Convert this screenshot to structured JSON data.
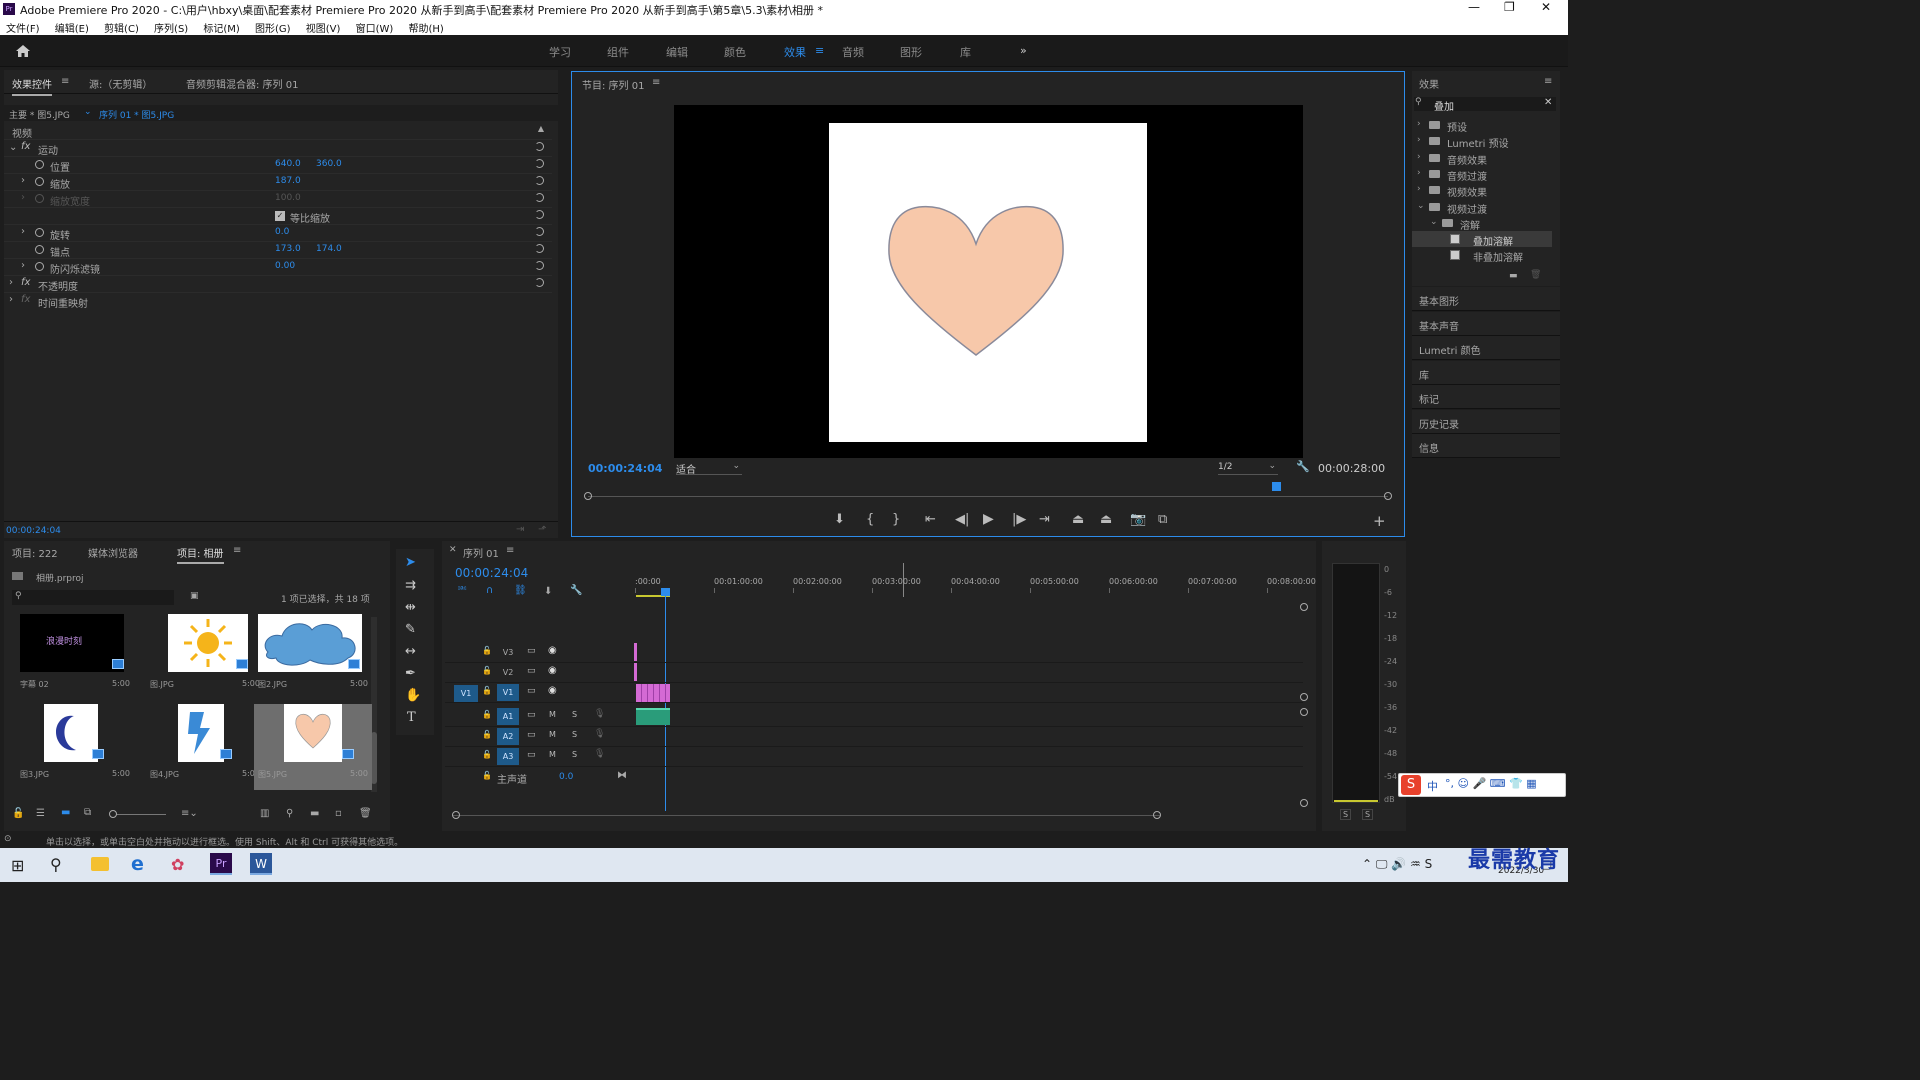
{
  "titlebar": {
    "title": "Adobe Premiere Pro 2020 - C:\\用户\\hbxy\\桌面\\配套素材 Premiere Pro 2020 从新手到高手\\配套素材 Premiere Pro 2020 从新手到高手\\第5章\\5.3\\素材\\相册 *"
  },
  "menu": [
    "文件(F)",
    "编辑(E)",
    "剪辑(C)",
    "序列(S)",
    "标记(M)",
    "图形(G)",
    "视图(V)",
    "窗口(W)",
    "帮助(H)"
  ],
  "workspaces": [
    "学习",
    "组件",
    "编辑",
    "颜色",
    "效果",
    "音频",
    "图形",
    "库"
  ],
  "active_workspace": "效果",
  "effect_controls": {
    "tabs": [
      "效果控件",
      "源:（无剪辑）",
      "音频剪辑混合器: 序列 01"
    ],
    "master": "主要 * 图5.JPG",
    "clip": "序列 01 * 图5.JPG",
    "section_video": "视频",
    "motion": "运动",
    "position_label": "位置",
    "position_x": "640.0",
    "position_y": "360.0",
    "scale_label": "缩放",
    "scale": "187.0",
    "scale_width_label": "缩放宽度",
    "scale_width": "100.0",
    "uniform_label": "等比缩放",
    "rotation_label": "旋转",
    "rotation": "0.0",
    "anchor_label": "锚点",
    "anchor_x": "173.0",
    "anchor_y": "174.0",
    "flicker_label": "防闪烁滤镜",
    "flicker": "0.00",
    "opacity": "不透明度",
    "time_remap": "时间重映射",
    "timecode": "00:00:24:04"
  },
  "program": {
    "title": "节目: 序列 01",
    "timecode": "00:00:24:04",
    "fit": "适合",
    "resolution": "1/2",
    "duration": "00:00:28:00",
    "playhead_fraction": 0.86
  },
  "effects": {
    "title": "效果",
    "search": "叠加",
    "items": [
      {
        "label": "预设",
        "level": 0
      },
      {
        "label": "Lumetri 预设",
        "level": 0
      },
      {
        "label": "音频效果",
        "level": 0
      },
      {
        "label": "音频过渡",
        "level": 0
      },
      {
        "label": "视频效果",
        "level": 0
      },
      {
        "label": "视频过渡",
        "level": 0
      },
      {
        "label": "溶解",
        "level": 1
      },
      {
        "label": "叠加溶解",
        "level": 2
      },
      {
        "label": "非叠加溶解",
        "level": 2
      }
    ],
    "panels": [
      "基本图形",
      "基本声音",
      "Lumetri 颜色",
      "库",
      "标记",
      "历史记录",
      "信息"
    ]
  },
  "project": {
    "tabs": [
      "项目: 222",
      "媒体浏览器",
      "项目: 相册"
    ],
    "file": "相册.prproj",
    "selection": "1 项已选择，共 18 项",
    "items": [
      {
        "name": "字幕 02",
        "dur": "5:00",
        "caption": "浪漫时刻"
      },
      {
        "name": "图.JPG",
        "dur": "5:00"
      },
      {
        "name": "图2.JPG",
        "dur": "5:00"
      },
      {
        "name": "图3.JPG",
        "dur": "5:00"
      },
      {
        "name": "图4.JPG",
        "dur": "5:00"
      },
      {
        "name": "图5.JPG",
        "dur": "5:00"
      }
    ]
  },
  "timeline": {
    "title": "序列 01",
    "timecode": "00:00:24:04",
    "ruler": [
      ":00:00",
      "00:01:00:00",
      "00:02:00:00",
      "00:03:00:00",
      "00:04:00:00",
      "00:05:00:00",
      "00:06:00:00",
      "00:07:00:00",
      "00:08:00:00"
    ],
    "video_tracks": [
      "V3",
      "V2",
      "V1"
    ],
    "audio_tracks": [
      "A1",
      "A2",
      "A3"
    ],
    "source_patch": "V1",
    "master_label": "主声道",
    "master_value": "0.0"
  },
  "meter": {
    "scale": [
      "0",
      "-6",
      "-12",
      "-18",
      "-24",
      "-30",
      "-36",
      "-42",
      "-48",
      "-54",
      "dB"
    ],
    "solo": [
      "S",
      "S"
    ]
  },
  "status": "单击以选择，或单击空白处并拖动以进行框选。使用 Shift、Alt 和 Ctrl 可获得其他选项。",
  "taskbar": {
    "date": "2022/3/30",
    "ime": "中"
  },
  "watermark": "最需教育"
}
